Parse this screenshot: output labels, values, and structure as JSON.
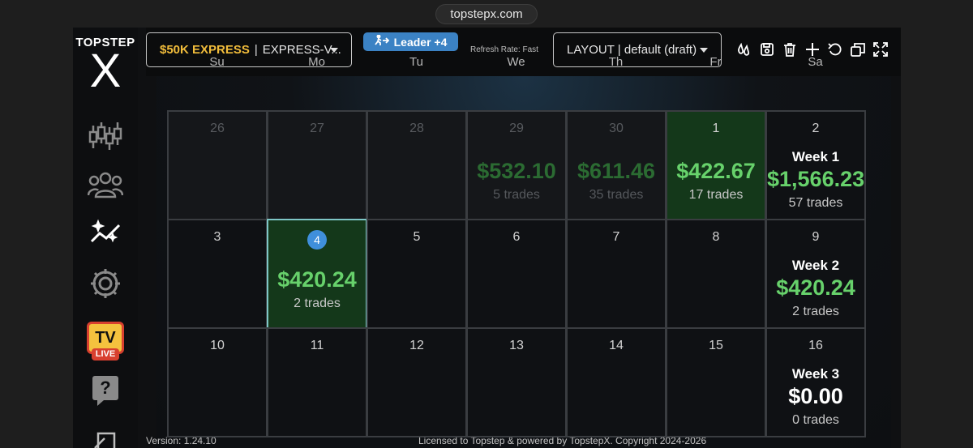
{
  "browser": {
    "url": "topstepx.com"
  },
  "brand": {
    "top": "TOPSTEP",
    "mark": "X"
  },
  "sidebar": {
    "items": [
      {
        "name": "chart-icon"
      },
      {
        "name": "users-icon"
      },
      {
        "name": "stats-icon"
      },
      {
        "name": "gear-icon"
      },
      {
        "name": "tv-live-icon",
        "label": "TV",
        "sublabel": "LIVE"
      },
      {
        "name": "help-icon",
        "label": "?"
      }
    ]
  },
  "toolbar": {
    "account_name": "$50K EXPRESS",
    "account_sep": "|",
    "account_id": "EXPRESS-V...",
    "leader_label": "Leader +4",
    "refresh_rate": "Refresh Rate: Fast",
    "layout_label": "LAYOUT | default (draft)",
    "tools": [
      "drops-icon",
      "save-icon",
      "trash-icon",
      "plus-icon",
      "undo-icon",
      "windows-icon",
      "expand-icon"
    ]
  },
  "calendar": {
    "weekdays": [
      "Su",
      "Mo",
      "Tu",
      "We",
      "Th",
      "Fr",
      "Sa"
    ],
    "weeks": [
      {
        "days": [
          {
            "num": "26",
            "pad": true
          },
          {
            "num": "27",
            "pad": true
          },
          {
            "num": "28",
            "pad": true
          },
          {
            "num": "29",
            "pad": true,
            "pnl": "$532.10",
            "trades": "5 trades"
          },
          {
            "num": "30",
            "pad": true,
            "pnl": "$611.46",
            "trades": "35 trades"
          },
          {
            "num": "1",
            "green": true,
            "pnl": "$422.67",
            "trades": "17 trades"
          }
        ],
        "summary": {
          "num": "2",
          "label": "Week 1",
          "pnl": "$1,566.23",
          "trades": "57 trades"
        }
      },
      {
        "days": [
          {
            "num": "3"
          },
          {
            "num": "4",
            "today": true,
            "pnl": "$420.24",
            "trades": "2 trades"
          },
          {
            "num": "5"
          },
          {
            "num": "6"
          },
          {
            "num": "7"
          },
          {
            "num": "8"
          }
        ],
        "summary": {
          "num": "9",
          "label": "Week 2",
          "pnl": "$420.24",
          "trades": "2 trades"
        }
      },
      {
        "days": [
          {
            "num": "10"
          },
          {
            "num": "11"
          },
          {
            "num": "12"
          },
          {
            "num": "13"
          },
          {
            "num": "14"
          },
          {
            "num": "15"
          }
        ],
        "summary": {
          "num": "16",
          "label": "Week 3",
          "pnl": "$0.00",
          "trades": "0 trades",
          "white": true
        }
      }
    ]
  },
  "footer": {
    "version": "Version: 1.24.10",
    "license": "Licensed to Topstep & powered by TopstepX. Copyright 2024-2026"
  }
}
